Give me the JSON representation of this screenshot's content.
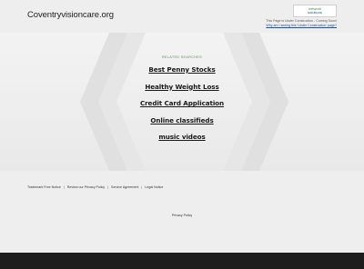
{
  "header": {
    "domain": "Coventryvisioncare.org",
    "logo_line1": "network",
    "logo_line2": "solutions",
    "construction_text": "This Page is Under Construction - Coming Soon!",
    "construction_link": "Why am I seeing this 'Under Construction' page?"
  },
  "hero": {
    "related_label": "RELATED SEARCHES",
    "links": [
      "Best Penny Stocks",
      "Healthy Weight Loss",
      "Credit Card Application",
      "Online classifieds",
      "music videos"
    ]
  },
  "footer": {
    "legal": [
      "Trademark Free Notice",
      "Review our Privacy Policy",
      "Service Agreement",
      "Legal Notice"
    ],
    "privacy": "Privacy Policy"
  },
  "colors": {
    "background": "#ebebeb",
    "bottom_bar": "#1d1d1d",
    "link": "#1a1a1a"
  }
}
